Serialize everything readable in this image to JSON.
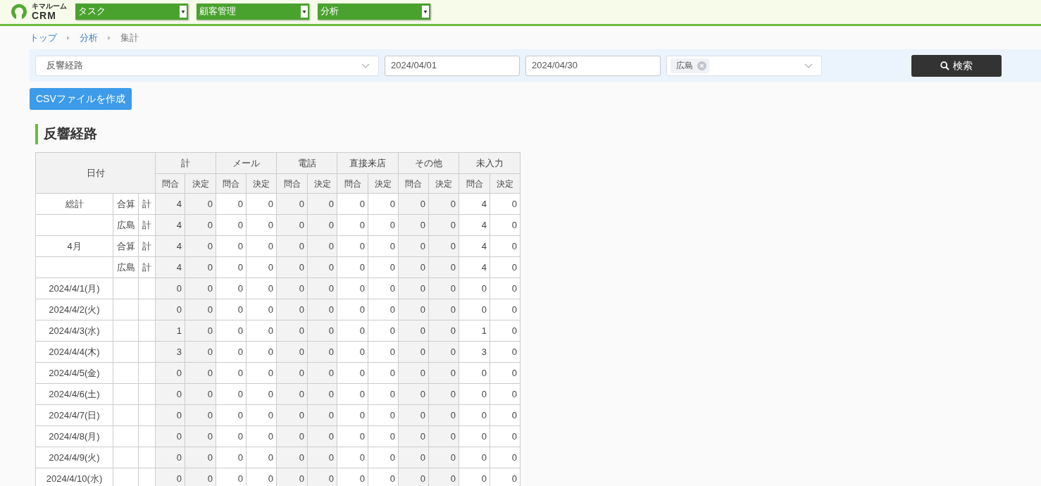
{
  "header": {
    "logo": {
      "caption": "キマルーム",
      "text": "CRM"
    },
    "menus": [
      {
        "label": "タスク"
      },
      {
        "label": "顧客管理"
      },
      {
        "label": "分析"
      }
    ]
  },
  "breadcrumb": [
    {
      "label": "トップ",
      "kind": "link"
    },
    {
      "label": "分析",
      "kind": "link"
    },
    {
      "label": "集計",
      "kind": "current"
    }
  ],
  "filters": {
    "category": {
      "value": "反響経路"
    },
    "date_from": {
      "value": "2024/04/01"
    },
    "date_to": {
      "value": "2024/04/30"
    },
    "stores": {
      "tags": [
        "広島"
      ]
    },
    "search_button": "検索"
  },
  "csv_button": "CSVファイルを作成",
  "section_title": "反響経路",
  "table": {
    "date_header": "日付",
    "groups": [
      {
        "label": "計",
        "columns": [
          "問合",
          "決定"
        ]
      },
      {
        "label": "メール",
        "columns": [
          "問合",
          "決定"
        ]
      },
      {
        "label": "電話",
        "columns": [
          "問合",
          "決定"
        ]
      },
      {
        "label": "直接来店",
        "columns": [
          "問合",
          "決定"
        ]
      },
      {
        "label": "その他",
        "columns": [
          "問合",
          "決定"
        ]
      },
      {
        "label": "未入力",
        "columns": [
          "問合",
          "決定"
        ]
      }
    ],
    "rows": [
      {
        "date": "総計",
        "store": "合算",
        "type": "計",
        "values": [
          "4",
          "0",
          "0",
          "0",
          "0",
          "0",
          "0",
          "0",
          "0",
          "0",
          "4",
          "0"
        ]
      },
      {
        "store": "広島",
        "type": "計",
        "values": [
          "4",
          "0",
          "0",
          "0",
          "0",
          "0",
          "0",
          "0",
          "0",
          "0",
          "4",
          "0"
        ]
      },
      {
        "date": "4月",
        "store": "合算",
        "type": "計",
        "values": [
          "4",
          "0",
          "0",
          "0",
          "0",
          "0",
          "0",
          "0",
          "0",
          "0",
          "4",
          "0"
        ]
      },
      {
        "store": "広島",
        "type": "計",
        "values": [
          "4",
          "0",
          "0",
          "0",
          "0",
          "0",
          "0",
          "0",
          "0",
          "0",
          "4",
          "0"
        ]
      },
      {
        "date": "2024/4/1(月)",
        "values": [
          "0",
          "0",
          "0",
          "0",
          "0",
          "0",
          "0",
          "0",
          "0",
          "0",
          "0",
          "0"
        ]
      },
      {
        "date": "2024/4/2(火)",
        "values": [
          "0",
          "0",
          "0",
          "0",
          "0",
          "0",
          "0",
          "0",
          "0",
          "0",
          "0",
          "0"
        ]
      },
      {
        "date": "2024/4/3(水)",
        "values": [
          "1",
          "0",
          "0",
          "0",
          "0",
          "0",
          "0",
          "0",
          "0",
          "0",
          "1",
          "0"
        ]
      },
      {
        "date": "2024/4/4(木)",
        "values": [
          "3",
          "0",
          "0",
          "0",
          "0",
          "0",
          "0",
          "0",
          "0",
          "0",
          "3",
          "0"
        ]
      },
      {
        "date": "2024/4/5(金)",
        "values": [
          "0",
          "0",
          "0",
          "0",
          "0",
          "0",
          "0",
          "0",
          "0",
          "0",
          "0",
          "0"
        ]
      },
      {
        "date": "2024/4/6(土)",
        "values": [
          "0",
          "0",
          "0",
          "0",
          "0",
          "0",
          "0",
          "0",
          "0",
          "0",
          "0",
          "0"
        ]
      },
      {
        "date": "2024/4/7(日)",
        "values": [
          "0",
          "0",
          "0",
          "0",
          "0",
          "0",
          "0",
          "0",
          "0",
          "0",
          "0",
          "0"
        ]
      },
      {
        "date": "2024/4/8(月)",
        "values": [
          "0",
          "0",
          "0",
          "0",
          "0",
          "0",
          "0",
          "0",
          "0",
          "0",
          "0",
          "0"
        ]
      },
      {
        "date": "2024/4/9(火)",
        "values": [
          "0",
          "0",
          "0",
          "0",
          "0",
          "0",
          "0",
          "0",
          "0",
          "0",
          "0",
          "0"
        ]
      },
      {
        "date": "2024/4/10(水)",
        "values": [
          "0",
          "0",
          "0",
          "0",
          "0",
          "0",
          "0",
          "0",
          "0",
          "0",
          "0",
          "0"
        ]
      }
    ]
  }
}
